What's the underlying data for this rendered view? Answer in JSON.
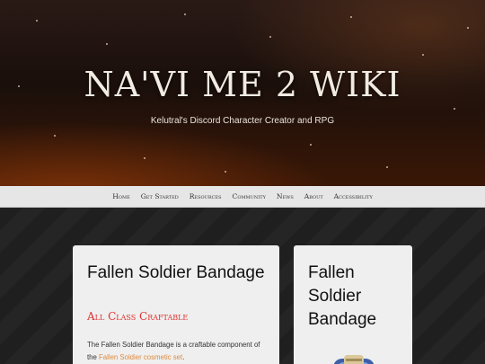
{
  "hero": {
    "title": "NA'VI ME 2 WIKI",
    "subtitle": "Kelutral's Discord Character Creator and RPG"
  },
  "nav": {
    "items": [
      "Home",
      "Get Started",
      "Resources",
      "Community",
      "News",
      "About",
      "Accessibility"
    ]
  },
  "main_card": {
    "title": "Fallen Soldier Bandage",
    "tag": "All Class Craftable",
    "body_prefix": "The Fallen Soldier Bandage is a craftable component of the ",
    "body_link": "Fallen Soldier cosmetic set",
    "body_suffix": "."
  },
  "side_card": {
    "title": "Fallen Soldier Bandage",
    "image_icon": "bandage-item-icon"
  },
  "colors": {
    "accent_red": "#e0302c",
    "link_orange": "#e08a3c",
    "nav_bg": "#e6e6e6"
  }
}
